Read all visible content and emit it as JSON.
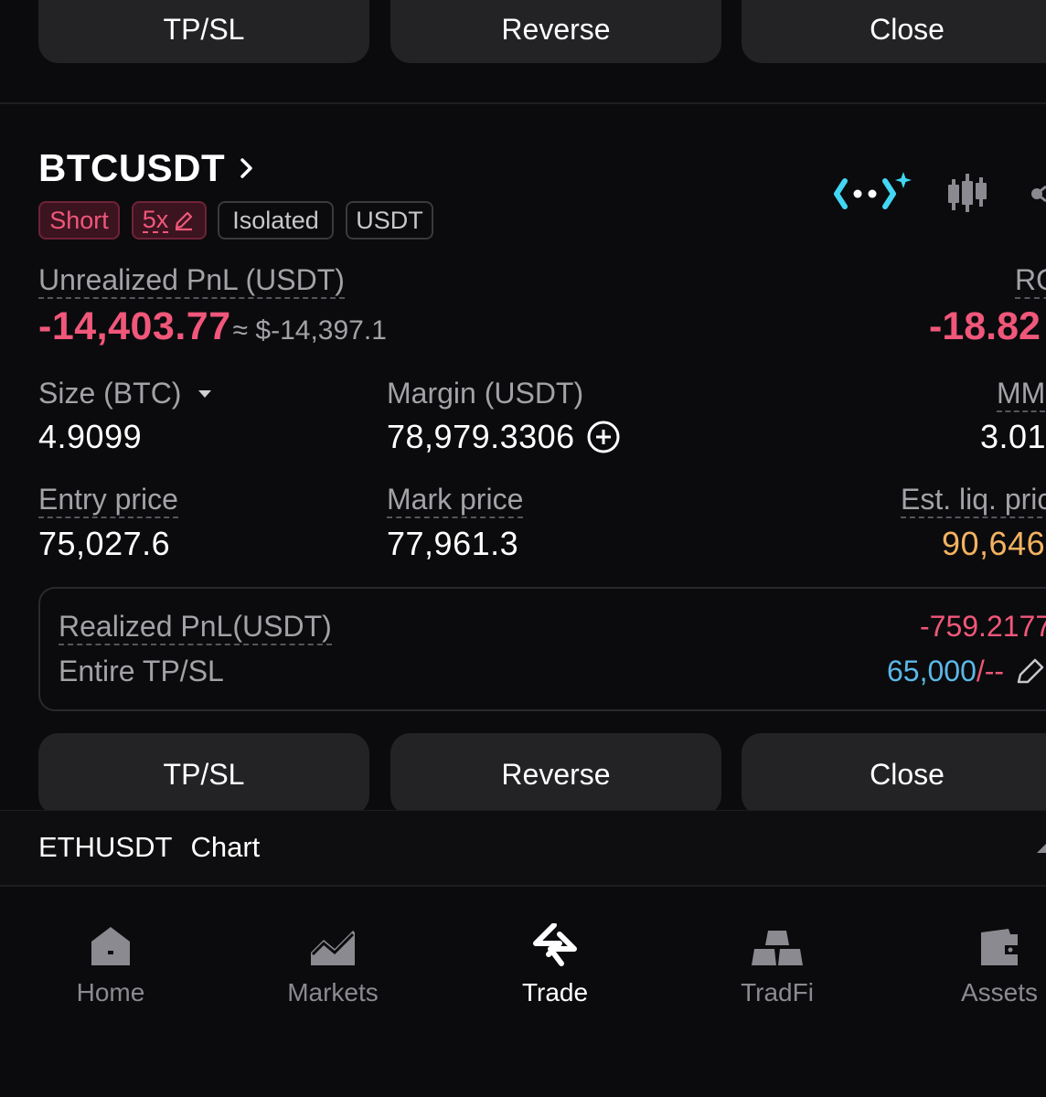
{
  "top_actions": {
    "tpsl": "TP/SL",
    "reverse": "Reverse",
    "close": "Close"
  },
  "position": {
    "symbol": "BTCUSDT",
    "tags": {
      "side": "Short",
      "leverage": "5x",
      "margin_mode": "Isolated",
      "settle": "USDT"
    },
    "unrealized_pnl_label": "Unrealized PnL (USDT)",
    "unrealized_pnl_value": "-14,403.77",
    "unrealized_pnl_usd": "≈ $-14,397.1",
    "roi_label": "RO",
    "roi_value": "-18.82",
    "size_label": "Size (BTC)",
    "size_value": "4.9099",
    "margin_label": "Margin (USDT)",
    "margin_value": "78,979.3306",
    "mm_label": "MM",
    "mm_value": "3.01",
    "entry_label": "Entry price",
    "entry_value": "75,027.6",
    "mark_label": "Mark price",
    "mark_value": "77,961.3",
    "liq_label": "Est. liq. pric",
    "liq_value": "90,646",
    "realized_pnl_label": "Realized PnL(USDT)",
    "realized_pnl_value": "-759.2177",
    "tpsl_label": "Entire TP/SL",
    "tpsl_value": "65,000",
    "tpsl_sl": "/--"
  },
  "bottom_actions": {
    "tpsl": "TP/SL",
    "reverse": "Reverse",
    "close": "Close"
  },
  "chart_bar": {
    "symbol": "ETHUSDT",
    "label": "Chart"
  },
  "nav": {
    "items": [
      {
        "label": "Home",
        "icon": "home-icon"
      },
      {
        "label": "Markets",
        "icon": "markets-icon"
      },
      {
        "label": "Trade",
        "icon": "trade-icon"
      },
      {
        "label": "TradFi",
        "icon": "tradfi-icon"
      },
      {
        "label": "Assets",
        "icon": "assets-icon"
      }
    ],
    "active": "Trade"
  },
  "colors": {
    "negative": "#f0577a",
    "warning": "#f3b261",
    "link": "#5bb8e8",
    "accent": "#42d6f5"
  }
}
